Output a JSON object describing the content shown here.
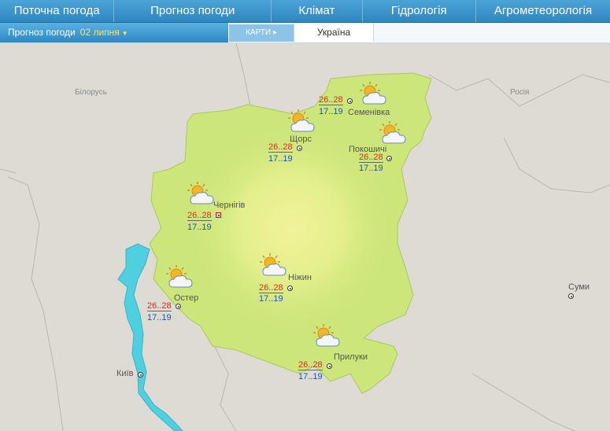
{
  "nav": {
    "items": [
      "Поточна погода",
      "Прогноз погоди",
      "Клімат",
      "Гідрологія",
      "Агрометеорологія"
    ]
  },
  "subbar": {
    "forecast_label": "Прогноз погоди",
    "date": "02 липня",
    "maps_label": "КАРТИ",
    "region": "Україна"
  },
  "countries": {
    "belarus": "Білорусь",
    "russia": "Росія"
  },
  "cities": {
    "chernihiv": {
      "name": "Чернігів",
      "tmax": "26..28",
      "tmin": "17..19"
    },
    "shchors": {
      "name": "Щорс",
      "tmax": "26..28",
      "tmin": "17..19"
    },
    "semenivka": {
      "name": "Семенівка",
      "tmax": "26..28",
      "tmin": "17..19"
    },
    "pokoshychi": {
      "name": "Покошичі",
      "tmax": "26..28",
      "tmin": "17..19"
    },
    "nizhyn": {
      "name": "Ніжин",
      "tmax": "26..28",
      "tmin": "17..19"
    },
    "oster": {
      "name": "Остер",
      "tmax": "26..28",
      "tmin": "17..19"
    },
    "pryluky": {
      "name": "Прилуки",
      "tmax": "26..28",
      "tmin": "17..19"
    },
    "kyiv": {
      "name": "Київ"
    },
    "sumy": {
      "name": "Суми"
    }
  },
  "weather_icon": "sun-behind-cloud-icon"
}
